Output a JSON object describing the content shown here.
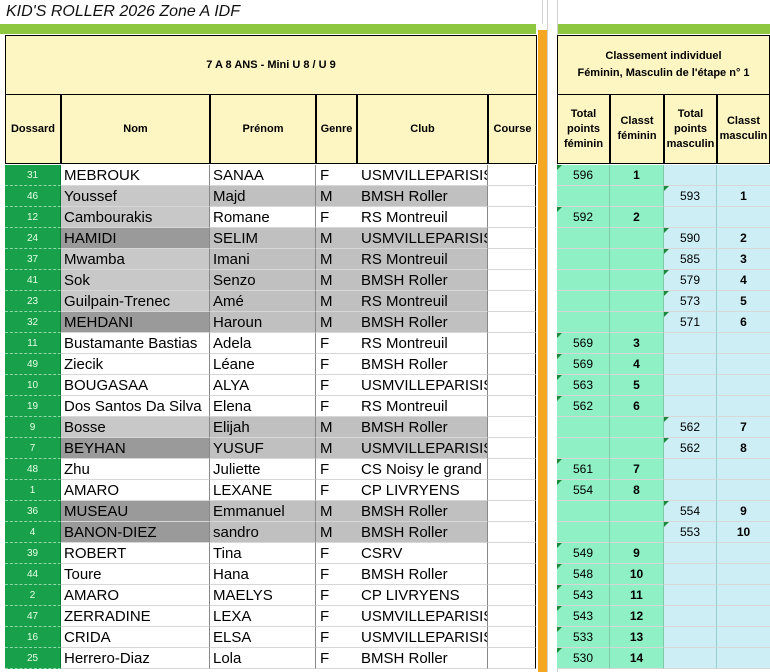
{
  "sheet_title": "KID'S ROLLER 2026 Zone A IDF",
  "category_header": "7 A 8 ANS - Mini   U 8 / U 9",
  "ranking_header": [
    "Classement individuel",
    "Féminin, Masculin de l'étape n° 1"
  ],
  "columns": {
    "dossard": "Dossard",
    "nom": "Nom",
    "prenom": "Prénom",
    "genre": "Genre",
    "club": "Club",
    "course": "Course",
    "total_fem": [
      "Total",
      "points",
      "féminin"
    ],
    "classt_fem": [
      "Classt",
      "féminin"
    ],
    "total_masc": [
      "Total",
      "points",
      "masculin"
    ],
    "classt_masc": [
      "Classt",
      "masculin"
    ]
  },
  "rows": [
    {
      "dossard": "31",
      "nom": "MEBROUK",
      "prenom": "SANAA",
      "genre": "F",
      "club": "USMVILLEPARISIS",
      "course": "",
      "total_fem": "596",
      "classt_fem": "1",
      "total_masc": "",
      "classt_masc": ""
    },
    {
      "dossard": "46",
      "nom": "Youssef",
      "prenom": "Majd",
      "genre": "M",
      "club": "BMSH Roller",
      "course": "",
      "total_fem": "",
      "classt_fem": "",
      "total_masc": "593",
      "classt_masc": "1"
    },
    {
      "dossard": "12",
      "nom": "Cambourakis",
      "prenom": "Romane",
      "genre": "F",
      "club": "RS Montreuil",
      "course": "",
      "total_fem": "592",
      "classt_fem": "2",
      "total_masc": "",
      "classt_masc": ""
    },
    {
      "dossard": "24",
      "nom": "HAMIDI",
      "prenom": "SELIM",
      "genre": "M",
      "club": "USMVILLEPARISIS",
      "course": "",
      "total_fem": "",
      "classt_fem": "",
      "total_masc": "590",
      "classt_masc": "2"
    },
    {
      "dossard": "37",
      "nom": "Mwamba",
      "prenom": "Imani",
      "genre": "M",
      "club": "RS Montreuil",
      "course": "",
      "total_fem": "",
      "classt_fem": "",
      "total_masc": "585",
      "classt_masc": "3"
    },
    {
      "dossard": "41",
      "nom": "Sok",
      "prenom": "Senzo",
      "genre": "M",
      "club": "BMSH Roller",
      "course": "",
      "total_fem": "",
      "classt_fem": "",
      "total_masc": "579",
      "classt_masc": "4"
    },
    {
      "dossard": "23",
      "nom": "Guilpain-Trenec",
      "prenom": "Amé",
      "genre": "M",
      "club": "RS Montreuil",
      "course": "",
      "total_fem": "",
      "classt_fem": "",
      "total_masc": "573",
      "classt_masc": "5"
    },
    {
      "dossard": "32",
      "nom": "MEHDANI",
      "prenom": "Haroun",
      "genre": "M",
      "club": "BMSH Roller",
      "course": "",
      "total_fem": "",
      "classt_fem": "",
      "total_masc": "571",
      "classt_masc": "6"
    },
    {
      "dossard": "11",
      "nom": "Bustamante Bastias",
      "prenom": "Adela",
      "genre": "F",
      "club": "RS Montreuil",
      "course": "",
      "total_fem": "569",
      "classt_fem": "3",
      "total_masc": "",
      "classt_masc": ""
    },
    {
      "dossard": "49",
      "nom": "Ziecik",
      "prenom": "Léane",
      "genre": "F",
      "club": "BMSH Roller",
      "course": "",
      "total_fem": "569",
      "classt_fem": "4",
      "total_masc": "",
      "classt_masc": ""
    },
    {
      "dossard": "10",
      "nom": "BOUGASAA",
      "prenom": "ALYA",
      "genre": "F",
      "club": "USMVILLEPARISIS",
      "course": "",
      "total_fem": "563",
      "classt_fem": "5",
      "total_masc": "",
      "classt_masc": ""
    },
    {
      "dossard": "19",
      "nom": "Dos Santos Da Silva",
      "prenom": "Elena",
      "genre": "F",
      "club": "RS Montreuil",
      "course": "",
      "total_fem": "562",
      "classt_fem": "6",
      "total_masc": "",
      "classt_masc": ""
    },
    {
      "dossard": "9",
      "nom": "Bosse",
      "prenom": "Elijah",
      "genre": "M",
      "club": "BMSH Roller",
      "course": "",
      "total_fem": "",
      "classt_fem": "",
      "total_masc": "562",
      "classt_masc": "7"
    },
    {
      "dossard": "7",
      "nom": "BEYHAN",
      "prenom": "YUSUF",
      "genre": "M",
      "club": "USMVILLEPARISIS",
      "course": "",
      "total_fem": "",
      "classt_fem": "",
      "total_masc": "562",
      "classt_masc": "8"
    },
    {
      "dossard": "48",
      "nom": "Zhu",
      "prenom": "Juliette",
      "genre": "F",
      "club": "CS Noisy le grand",
      "course": "",
      "total_fem": "561",
      "classt_fem": "7",
      "total_masc": "",
      "classt_masc": ""
    },
    {
      "dossard": "1",
      "nom": "AMARO",
      "prenom": "LEXANE",
      "genre": "F",
      "club": "CP LIVRYENS",
      "course": "",
      "total_fem": "554",
      "classt_fem": "8",
      "total_masc": "",
      "classt_masc": ""
    },
    {
      "dossard": "36",
      "nom": "MUSEAU",
      "prenom": "Emmanuel",
      "genre": "M",
      "club": "BMSH Roller",
      "course": "",
      "total_fem": "",
      "classt_fem": "",
      "total_masc": "554",
      "classt_masc": "9"
    },
    {
      "dossard": "4",
      "nom": "BANON-DIEZ",
      "prenom": "sandro",
      "genre": "M",
      "club": "BMSH Roller",
      "course": "",
      "total_fem": "",
      "classt_fem": "",
      "total_masc": "553",
      "classt_masc": "10"
    },
    {
      "dossard": "39",
      "nom": "ROBERT",
      "prenom": "Tina",
      "genre": "F",
      "club": "CSRV",
      "course": "",
      "total_fem": "549",
      "classt_fem": "9",
      "total_masc": "",
      "classt_masc": ""
    },
    {
      "dossard": "44",
      "nom": "Toure",
      "prenom": "Hana",
      "genre": "F",
      "club": "BMSH Roller",
      "course": "",
      "total_fem": "548",
      "classt_fem": "10",
      "total_masc": "",
      "classt_masc": ""
    },
    {
      "dossard": "2",
      "nom": "AMARO",
      "prenom": "MAELYS",
      "genre": "F",
      "club": "CP LIVRYENS",
      "course": "",
      "total_fem": "543",
      "classt_fem": "11",
      "total_masc": "",
      "classt_masc": ""
    },
    {
      "dossard": "47",
      "nom": "ZERRADINE",
      "prenom": "LEXA",
      "genre": "F",
      "club": "USMVILLEPARISIS",
      "course": "",
      "total_fem": "543",
      "classt_fem": "12",
      "total_masc": "",
      "classt_masc": ""
    },
    {
      "dossard": "16",
      "nom": "CRIDA",
      "prenom": "ELSA",
      "genre": "F",
      "club": "USMVILLEPARISIS",
      "course": "",
      "total_fem": "533",
      "classt_fem": "13",
      "total_masc": "",
      "classt_masc": ""
    },
    {
      "dossard": "25",
      "nom": "Herrero-Diaz",
      "prenom": "Lola",
      "genre": "F",
      "club": "BMSH Roller",
      "course": "",
      "total_fem": "530",
      "classt_fem": "14",
      "total_masc": "",
      "classt_masc": ""
    }
  ]
}
